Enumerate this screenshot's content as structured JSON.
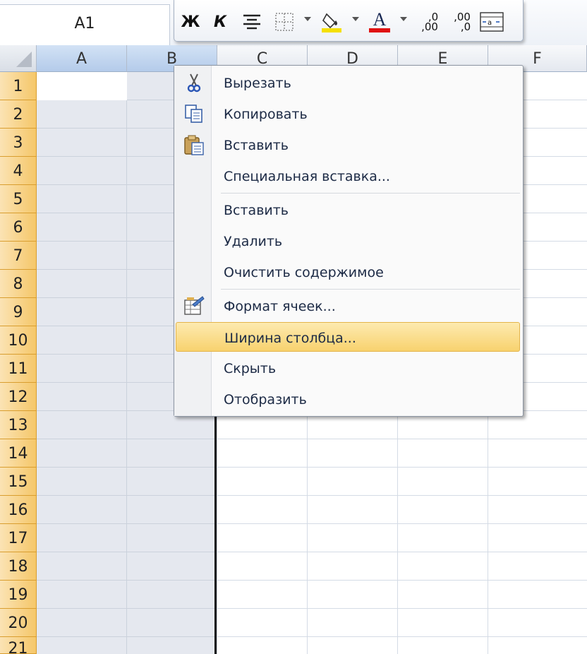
{
  "name_box": {
    "value": "A1"
  },
  "mini_toolbar": {
    "bold": "Ж",
    "italic": "К",
    "align_icon": "align-center-icon",
    "borders_icon": "borders-icon",
    "fill_icon": "fill-color-icon",
    "font_color_label": "A",
    "increase_decimal_a": ",0",
    "increase_decimal_b": ",00",
    "decrease_decimal_a": ",00",
    "decrease_decimal_b": ",0",
    "merge_icon": "merge-center-icon",
    "fill_color": "#f5e000",
    "font_color": "#e01010"
  },
  "columns": [
    "A",
    "B",
    "C",
    "D",
    "E",
    "F"
  ],
  "rows": [
    "1",
    "2",
    "3",
    "4",
    "5",
    "6",
    "7",
    "8",
    "9",
    "10",
    "11",
    "12",
    "13",
    "14",
    "15",
    "16",
    "17",
    "18",
    "19",
    "20",
    "21"
  ],
  "context_menu": {
    "items": [
      {
        "label": "Вырезать",
        "icon": "scissors-icon"
      },
      {
        "label": "Копировать",
        "icon": "copy-icon"
      },
      {
        "label": "Вставить",
        "icon": "paste-icon"
      },
      {
        "label": "Специальная вставка...",
        "icon": ""
      },
      {
        "label": "Вставить",
        "icon": ""
      },
      {
        "label": "Удалить",
        "icon": ""
      },
      {
        "label": "Очистить содержимое",
        "icon": ""
      },
      {
        "label": "Формат ячеек...",
        "icon": "format-cells-icon"
      },
      {
        "label": "Ширина столбца...",
        "icon": "",
        "highlighted": true
      },
      {
        "label": "Скрыть",
        "icon": ""
      },
      {
        "label": "Отобразить",
        "icon": ""
      }
    ]
  }
}
